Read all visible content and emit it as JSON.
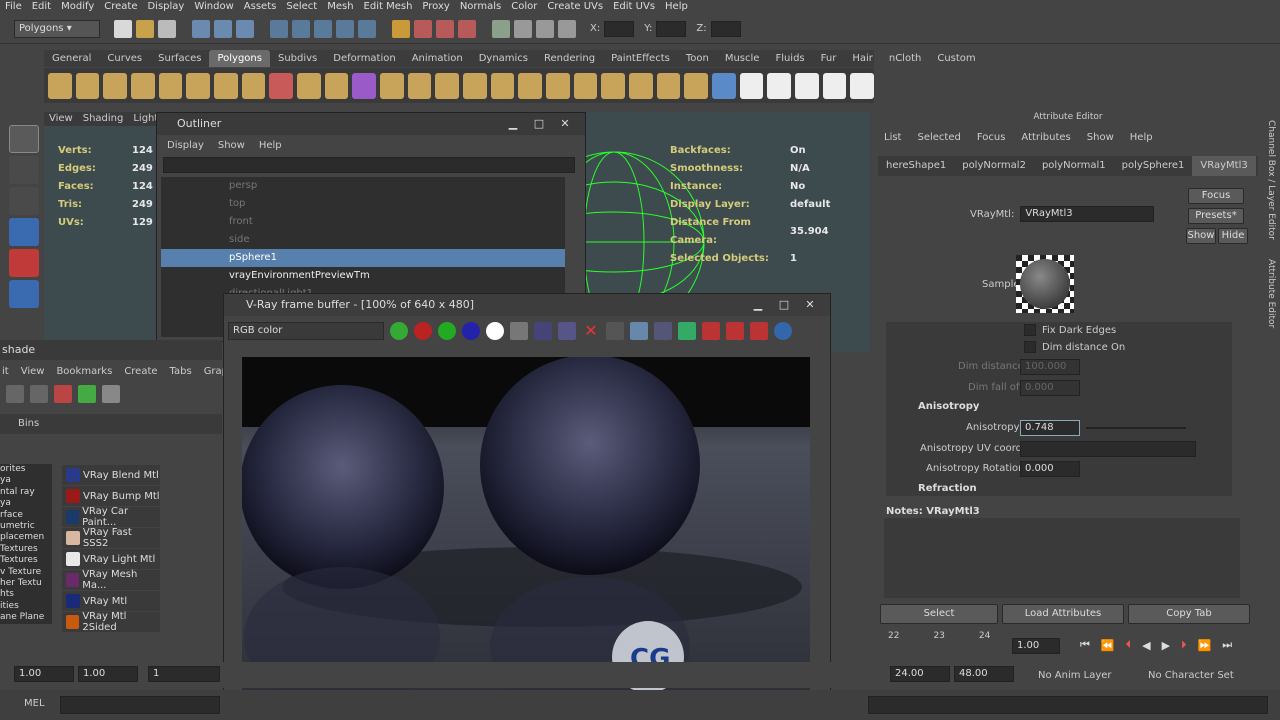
{
  "menubar": [
    "File",
    "Edit",
    "Modify",
    "Create",
    "Display",
    "Window",
    "Assets",
    "Select",
    "Mesh",
    "Edit Mesh",
    "Proxy",
    "Normals",
    "Color",
    "Create UVs",
    "Edit UVs",
    "Help"
  ],
  "status": {
    "menu_set": "Polygons",
    "x_label": "X:",
    "y_label": "Y:",
    "z_label": "Z:"
  },
  "shelf_tabs": [
    "General",
    "Curves",
    "Surfaces",
    "Polygons",
    "Subdivs",
    "Deformation",
    "Animation",
    "Dynamics",
    "Rendering",
    "PaintEffects",
    "Toon",
    "Muscle",
    "Fluids",
    "Fur",
    "Hair",
    "nCloth",
    "Custom"
  ],
  "shelf_active": "Polygons",
  "viewport": {
    "menu": [
      "View",
      "Shading",
      "Lighti"
    ],
    "hud_left": [
      {
        "label": "Verts:",
        "value": "124"
      },
      {
        "label": "Edges:",
        "value": "249"
      },
      {
        "label": "Faces:",
        "value": "124"
      },
      {
        "label": "Tris:",
        "value": "249"
      },
      {
        "label": "UVs:",
        "value": "129"
      }
    ],
    "hud_right": [
      {
        "label": "Backfaces:",
        "value": "On"
      },
      {
        "label": "Smoothness:",
        "value": "N/A"
      },
      {
        "label": "Instance:",
        "value": "No"
      },
      {
        "label": "Display Layer:",
        "value": "default"
      },
      {
        "label": "Distance From Camera:",
        "value": "35.904"
      },
      {
        "label": "Selected Objects:",
        "value": "1"
      }
    ]
  },
  "outliner": {
    "title": "Outliner",
    "menu": [
      "Display",
      "Show",
      "Help"
    ],
    "items": [
      {
        "label": "persp",
        "state": "dim"
      },
      {
        "label": "top",
        "state": "dim"
      },
      {
        "label": "front",
        "state": "dim"
      },
      {
        "label": "side",
        "state": "dim"
      },
      {
        "label": "pSphere1",
        "state": "sel"
      },
      {
        "label": "vrayEnvironmentPreviewTm",
        "state": "act"
      },
      {
        "label": "directionalLight1",
        "state": "dim"
      }
    ]
  },
  "hypershade": {
    "title": "shade",
    "menu": [
      "it",
      "View",
      "Bookmarks",
      "Create",
      "Tabs",
      "Graph"
    ],
    "bins_tab": "Bins",
    "tree": [
      "orites",
      "ya",
      "ntal ray",
      "ya",
      "rface",
      "umetric",
      "placemen",
      "Textures",
      "Textures",
      "v Texture",
      "her Textu",
      "hts",
      "ities",
      "ane Plane"
    ],
    "materials": [
      {
        "label": "VRay Blend Mtl",
        "color": "#2a3a8a"
      },
      {
        "label": "VRay Bump Mtl",
        "color": "#9a1a1a"
      },
      {
        "label": "VRay Car Paint...",
        "color": "#1a3a6a"
      },
      {
        "label": "VRay Fast SSS2",
        "color": "#d8b8a0"
      },
      {
        "label": "VRay Light Mtl",
        "color": "#e8e8e8"
      },
      {
        "label": "VRay Mesh Ma...",
        "color": "#6a2a6a"
      },
      {
        "label": "VRay Mtl",
        "color": "#1a2a7a"
      },
      {
        "label": "VRay Mtl 2Sided",
        "color": "#c85a10"
      }
    ]
  },
  "vfb": {
    "title": "V-Ray frame buffer - [100% of 640 x 480]",
    "channel": "RGB color"
  },
  "attribute_editor": {
    "header": "Attribute Editor",
    "menu": [
      "List",
      "Selected",
      "Focus",
      "Attributes",
      "Show",
      "Help"
    ],
    "tabs": [
      "hereShape1",
      "polyNormal2",
      "polyNormal1",
      "polySphere1",
      "VRayMtl3"
    ],
    "active_tab": "VRayMtl3",
    "node_label": "VRayMtl:",
    "node_value": "VRayMtl3",
    "focus_btn": "Focus",
    "presets_btn": "Presets*",
    "show_btn": "Show",
    "hide_btn": "Hide",
    "sample_label": "Sample",
    "fix_dark_edges": "Fix Dark Edges",
    "dim_distance_on": "Dim distance On",
    "dim_distance_label": "Dim distance",
    "dim_distance_value": "100.000",
    "dim_falloff_label": "Dim fall off",
    "dim_falloff_value": "0.000",
    "anisotropy_section": "Anisotropy",
    "anisotropy_label": "Anisotropy",
    "anisotropy_value": "0.748",
    "aniso_uv_label": "Anisotropy UV coords",
    "aniso_rot_label": "Anisotropy Rotation",
    "aniso_rot_value": "0.000",
    "refraction_section": "Refraction",
    "notes_label": "Notes:  VRayMtl3",
    "select_btn": "Select",
    "load_btn": "Load Attributes",
    "copy_btn": "Copy Tab",
    "side_tabs": "Channel Box / Layer Editor",
    "side_tabs2": "Attribute Editor"
  },
  "timeline": {
    "ticks": [
      "22",
      "23",
      "24"
    ],
    "current": "1.00"
  },
  "range": {
    "start_left": "1.00",
    "start_right": "1.00",
    "frame": "1",
    "end_a": "24.00",
    "end_b": "48.00",
    "anim_layer": "No Anim Layer",
    "char_set": "No Character Set"
  },
  "mel": {
    "label": "MEL"
  },
  "watermark": "CG"
}
